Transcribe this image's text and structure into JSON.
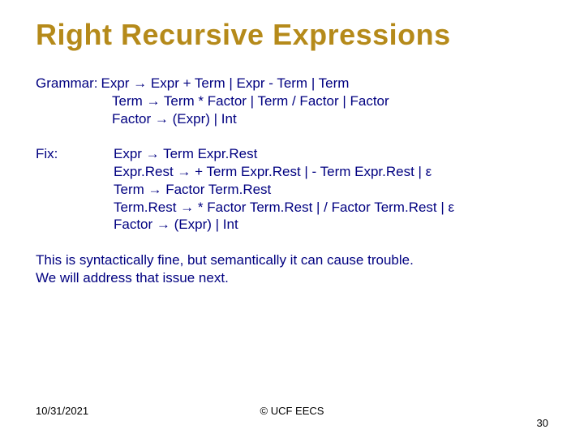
{
  "title": "Right Recursive Expressions",
  "grammar": {
    "label": "Grammar:",
    "rule1": "Expr → Expr + Term | Expr - Term | Term",
    "rule2": "Term → Term * Factor | Term / Factor | Factor",
    "rule3": "Factor → (Expr) | Int"
  },
  "fix": {
    "label": "Fix:",
    "rule1": "Expr → Term Expr.Rest",
    "rule2": "Expr.Rest → + Term Expr.Rest | - Term Expr.Rest | ε",
    "rule3": "Term → Factor Term.Rest",
    "rule4": "Term.Rest → * Factor Term.Rest | / Factor Term.Rest | ε",
    "rule5": "Factor → (Expr) | Int"
  },
  "note": {
    "line1": "This is syntactically fine, but semantically it can cause trouble.",
    "line2": "We will address that issue next."
  },
  "footer": {
    "date": "10/31/2021",
    "center": "© UCF EECS",
    "page": "30"
  }
}
